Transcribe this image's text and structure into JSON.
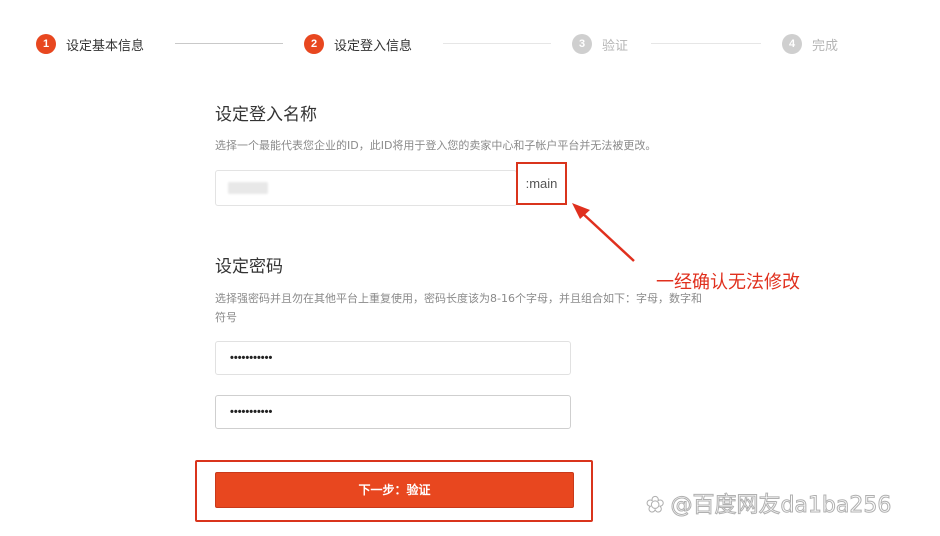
{
  "stepper": {
    "steps": [
      {
        "number": "1",
        "label": "设定基本信息",
        "state": "done"
      },
      {
        "number": "2",
        "label": "设定登入信息",
        "state": "active"
      },
      {
        "number": "3",
        "label": "验证",
        "state": "inactive"
      },
      {
        "number": "4",
        "label": "完成",
        "state": "inactive"
      }
    ]
  },
  "login_name": {
    "title": "设定登入名称",
    "description": "选择一个最能代表您企业的ID，此ID将用于登入您的卖家中心和子帐户平台并无法被更改。",
    "suffix": ":main"
  },
  "password": {
    "title": "设定密码",
    "description": "选择强密码并且勿在其他平台上重复使用，密码长度该为8-16个字母，并且组合如下：字母，数字和符号",
    "value": "•••••••••••",
    "confirm_value": "•••••••••••"
  },
  "actions": {
    "next_label": "下一步：验证"
  },
  "annotation": {
    "text": "一经确认无法修改"
  },
  "watermark": {
    "text": "@百度网友da1ba256"
  },
  "colors": {
    "accent": "#e8471f",
    "annotation_red": "#d9341c",
    "inactive_step": "#cfcfcf"
  }
}
